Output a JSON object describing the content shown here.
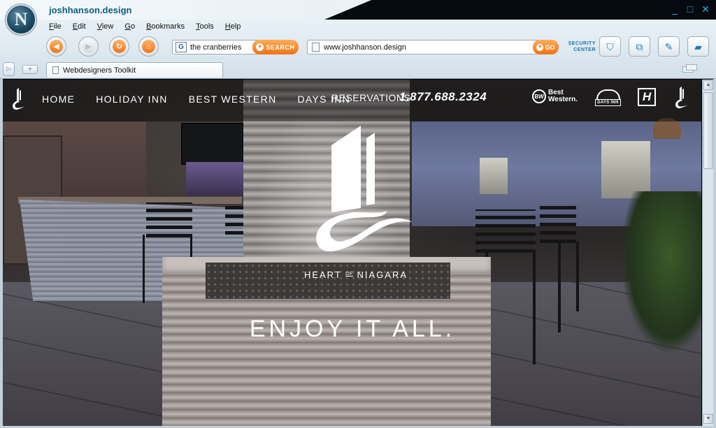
{
  "window": {
    "title": "joshhanson.design",
    "logo_letter": "N",
    "controls": [
      "_",
      "□",
      "✕"
    ]
  },
  "menu": [
    "File",
    "Edit",
    "View",
    "Go",
    "Bookmarks",
    "Tools",
    "Help"
  ],
  "toolbar": {
    "search_engine_icon": "G",
    "search_value": "the cranberries",
    "search_button": "SEARCH",
    "url_value": "www.joshhanson.design",
    "go_button": "GO",
    "security_label_1": "SECURITY",
    "security_label_2": "CENTER",
    "icons": [
      "back-arrow-icon",
      "forward-arrow-icon",
      "reload-icon",
      "home-icon",
      "shield-check-icon",
      "window-switch-icon",
      "edit-pen-icon",
      "eraser-icon"
    ]
  },
  "tabs": [
    {
      "label": "Webdesigners Toolkit"
    }
  ],
  "site": {
    "nav": [
      "HOME",
      "HOLIDAY INN",
      "BEST WESTERN",
      "DAYS INN"
    ],
    "reservations_label": "RESERVATIONS",
    "reservations_phone": "1.877.688.2324",
    "brands": {
      "best_western_abbr": "BW",
      "best_western_line1": "Best",
      "best_western_line2": "Western.",
      "days_inn": "DAYS INN",
      "holiday_inn": "H"
    },
    "hero_name_1": "HEART",
    "hero_name_of": "OF",
    "hero_name_2": "NIAGARA",
    "tagline": "ENJOY IT ALL."
  },
  "colors": {
    "accent_orange": "#f07215",
    "title_teal": "#0b5f7e",
    "security_blue": "#1a76a8"
  }
}
